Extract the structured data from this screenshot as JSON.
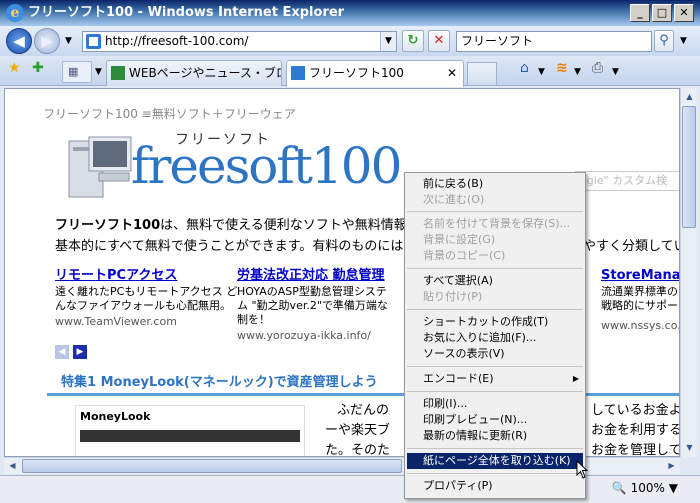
{
  "window": {
    "title": "フリーソフト100 - Windows Internet Explorer"
  },
  "nav": {
    "url": "http://freesoft-100.com/",
    "search_text": "フリーソフト"
  },
  "tabs": [
    {
      "label": "WEBページやニュース・ブログ..."
    },
    {
      "label": "フリーソフト100"
    }
  ],
  "status": {
    "zoom": "100%"
  },
  "page": {
    "site_header": "フリーソフト100 ≡無料ソフト＋フリーウェア",
    "logo_kana": "フリーソフト",
    "logo_text": "freesoft100",
    "google_placeholder": "ogle\" カスタム検",
    "intro_bold": "フリーソフト100",
    "intro_line1": "は、無料で使える便利なソフトや無料情報を",
    "intro_line2": "基本的にすべて無料で使うことができます。有料のものには",
    "intro_right": "やすく分類してい",
    "ads": [
      {
        "title": "リモートPCアクセス",
        "desc1": "遠く離れたPCもリモートアクセス ど",
        "desc2": "んなファイアウォールも心配無用。",
        "url": "www.TeamViewer.com"
      },
      {
        "title": "労基法改正対応 勤怠管理",
        "desc1": "HOYAのASP型勤怠管理システ",
        "desc2": "ム \"勤之助ver.2\"で準備万端な",
        "desc3": "制を！",
        "url": "www.yorozuya-ikka.info/"
      },
      {
        "title": "StoreMana",
        "desc1": "流通業界標準の",
        "desc2": "戦略的にサポー",
        "url": "www.nssys.co.jp"
      }
    ],
    "feature_title": "特集1  MoneyLook(マネールック)で資産管理しよう",
    "money_brand": "MoneyLook",
    "body_lines": [
      "ふだんの",
      "ーや楽天ブ",
      "た。そのた"
    ],
    "body_right": [
      "しているお金よ",
      "お金を利用する",
      "お金を管理して"
    ]
  },
  "context_menu": {
    "items": [
      {
        "label": "前に戻る(B)",
        "disabled": false
      },
      {
        "label": "次に進む(O)",
        "disabled": true
      },
      {
        "label": "名前を付けて背景を保存(S)...",
        "disabled": true
      },
      {
        "label": "背景に設定(G)",
        "disabled": true
      },
      {
        "label": "背景のコピー(C)",
        "disabled": true
      },
      {
        "label": "すべて選択(A)",
        "disabled": false
      },
      {
        "label": "貼り付け(P)",
        "disabled": true
      },
      {
        "label": "ショートカットの作成(T)",
        "disabled": false
      },
      {
        "label": "お気に入りに追加(F)...",
        "disabled": false
      },
      {
        "label": "ソースの表示(V)",
        "disabled": false
      },
      {
        "label": "エンコード(E)",
        "disabled": false
      },
      {
        "label": "印刷(I)...",
        "disabled": false
      },
      {
        "label": "印刷プレビュー(N)...",
        "disabled": false
      },
      {
        "label": "最新の情報に更新(R)",
        "disabled": false
      },
      {
        "label": "紙にページ全体を取り込む(K)",
        "disabled": false
      },
      {
        "label": "プロパティ(P)",
        "disabled": false
      }
    ]
  }
}
